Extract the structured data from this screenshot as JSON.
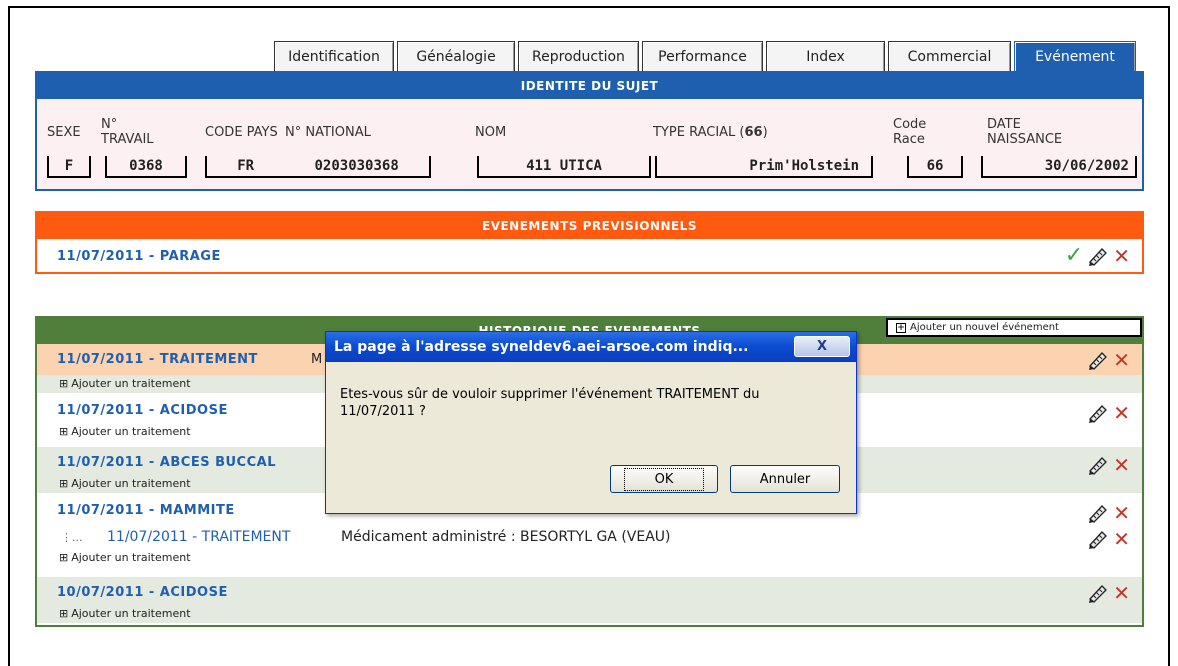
{
  "tabs": [
    "Identification",
    "Généalogie",
    "Reproduction",
    "Performance",
    "Index",
    "Commercial",
    "Evénement"
  ],
  "identity": {
    "title": "IDENTITE DU SUJET",
    "labels": {
      "sexe": "SEXE",
      "travail": "N°\nTRAVAIL",
      "pays": "CODE PAYS",
      "national": "N° NATIONAL",
      "nom": "NOM",
      "type_racial": "TYPE RACIAL (",
      "type_racial_code": "66",
      "type_racial_end": ")",
      "code_race": "Code\nRace",
      "date_naissance": "DATE\nNAISSANCE"
    },
    "values": {
      "sexe": "F",
      "travail": "0368",
      "pays": "FR",
      "national": "0203030368",
      "nom": "411 UTICA",
      "type_racial": "Prim'Holstein",
      "code_race": "66",
      "date_naissance": "30/06/2002"
    }
  },
  "previsionnels": {
    "title": "EVENEMENTS PREVISIONNELS",
    "items": [
      {
        "label": "11/07/2011 - PARAGE"
      }
    ]
  },
  "historique": {
    "title": "HISTORIQUE DES EVENEMENTS",
    "add_event": "Ajouter un nouvel événement",
    "add_treatment": "Ajouter un traitement",
    "row1": {
      "label": "11/07/2011 - TRAITEMENT",
      "extra": "M"
    },
    "row2": {
      "label": "11/07/2011 - ACIDOSE"
    },
    "row3": {
      "label": "11/07/2011 - ABCES BUCCAL"
    },
    "row4": {
      "label": "11/07/2011 - MAMMITE",
      "sub_prefix": "⋮...",
      "sub_label": "11/07/2011 - TRAITEMENT",
      "sub_detail": "Médicament administré : BESORTYL GA (VEAU)"
    },
    "row5": {
      "label": "10/07/2011 - ACIDOSE"
    }
  },
  "dialog": {
    "title": "La page à l'adresse syneldev6.aei-arsoe.com indiq...",
    "close": "X",
    "message": "Etes-vous sûr de vouloir supprimer l'événement TRAITEMENT du 11/07/2011 ?",
    "ok": "OK",
    "cancel": "Annuler"
  },
  "colors": {
    "blue": "#1f5fb0",
    "orange": "#ff5a10",
    "green": "#4f7f3a",
    "delete": "#c0392b",
    "validate": "#3da13d"
  }
}
